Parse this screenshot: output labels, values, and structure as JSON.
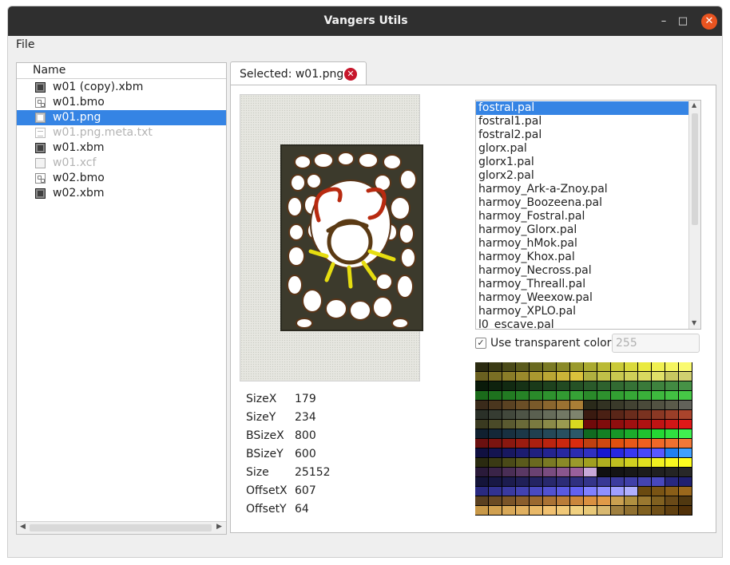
{
  "window": {
    "title": "Vangers Utils"
  },
  "window_controls": {
    "minimize": "–",
    "maximize": "□",
    "close": "✕"
  },
  "menubar": {
    "file": "File"
  },
  "file_tree": {
    "header": "Name",
    "items": [
      {
        "label": "w01 (copy).xbm",
        "icon": "image-file-icon",
        "selected": false,
        "dimmed": false
      },
      {
        "label": "w01.bmo",
        "icon": "binary-file-icon",
        "selected": false,
        "dimmed": false
      },
      {
        "label": "w01.png",
        "icon": "image-file-icon",
        "selected": true,
        "dimmed": false
      },
      {
        "label": "w01.png.meta.txt",
        "icon": "text-file-icon",
        "selected": false,
        "dimmed": true
      },
      {
        "label": "w01.xbm",
        "icon": "image-file-icon",
        "selected": false,
        "dimmed": false
      },
      {
        "label": "w01.xcf",
        "icon": "xcf-file-icon",
        "selected": false,
        "dimmed": true
      },
      {
        "label": "w02.bmo",
        "icon": "binary-file-icon",
        "selected": false,
        "dimmed": false
      },
      {
        "label": "w02.xbm",
        "icon": "image-file-icon",
        "selected": false,
        "dimmed": false
      }
    ]
  },
  "tab": {
    "label": "Selected: w01.png"
  },
  "properties": [
    {
      "key": "SizeX",
      "value": "179"
    },
    {
      "key": "SizeY",
      "value": "234"
    },
    {
      "key": "BSizeX",
      "value": "800"
    },
    {
      "key": "BSizeY",
      "value": "600"
    },
    {
      "key": "Size",
      "value": "25152"
    },
    {
      "key": "OffsetX",
      "value": "607"
    },
    {
      "key": "OffsetY",
      "value": "64"
    }
  ],
  "palettes": {
    "selected": "fostral.pal",
    "items": [
      "fostral.pal",
      "fostral1.pal",
      "fostral2.pal",
      "glorx.pal",
      "glorx1.pal",
      "glorx2.pal",
      "harmoy_Ark-a-Znoy.pal",
      "harmoy_Boozeena.pal",
      "harmoy_Fostral.pal",
      "harmoy_Glorx.pal",
      "harmoy_hMok.pal",
      "harmoy_Khox.pal",
      "harmoy_Necross.pal",
      "harmoy_Threall.pal",
      "harmoy_Weexow.pal",
      "harmoy_XPLO.pal",
      "l0_escave.pal"
    ]
  },
  "transparency": {
    "label": "Use transparent color",
    "checked": true,
    "value": "255"
  },
  "palette_rows": [
    [
      "#2a2a10",
      "#3a3a14",
      "#4a4a18",
      "#5a5a1c",
      "#6a6a20",
      "#7a7a24",
      "#8a8a28",
      "#9a9a2c",
      "#aaaa30",
      "#baba34",
      "#caca38",
      "#dada3c",
      "#eaea40",
      "#f0f050",
      "#f5f560",
      "#fafa70"
    ],
    [
      "#6a6020",
      "#7a6e24",
      "#8a7c28",
      "#9a8a2c",
      "#aa9830",
      "#baa634",
      "#cab438",
      "#dac23c",
      "#b0b040",
      "#c0c048",
      "#c8c850",
      "#d0d058",
      "#d8d860",
      "#e0e068",
      "#c8c860",
      "#d0d070"
    ],
    [
      "#0a1a0a",
      "#0e220e",
      "#122a12",
      "#163216",
      "#1a3a1a",
      "#1e421e",
      "#224a22",
      "#265226",
      "#2a5a2a",
      "#2e622e",
      "#326a32",
      "#367236",
      "#3a7a3a",
      "#3e823e",
      "#428a42",
      "#469246"
    ],
    [
      "#1a6a1a",
      "#1e721e",
      "#227a22",
      "#268226",
      "#2a8a2a",
      "#2e922e",
      "#329a32",
      "#36a236",
      "#2a8a2a",
      "#2e922e",
      "#32a032",
      "#36a836",
      "#3ab03a",
      "#3eb83e",
      "#42c042",
      "#46c846"
    ],
    [
      "#3a2a1a",
      "#4a361e",
      "#5a4222",
      "#6a4e26",
      "#7a5a2a",
      "#8a662e",
      "#9a7232",
      "#aa7e36",
      "#2a2a1a",
      "#323222",
      "#3a3a2a",
      "#424232",
      "#4a4a3a",
      "#525242",
      "#5a5a4a",
      "#62625a"
    ],
    [
      "#2a3028",
      "#363c32",
      "#42483c",
      "#4e5446",
      "#5a6050",
      "#666c5a",
      "#727864",
      "#7e846e",
      "#3a1a10",
      "#4a2014",
      "#5a2618",
      "#6a2c1c",
      "#7a3220",
      "#8a3824",
      "#9a3e28",
      "#aa442c"
    ],
    [
      "#3a3a20",
      "#4a4a28",
      "#5a5a30",
      "#6a6a38",
      "#7a7a40",
      "#8a8a48",
      "#9a9a50",
      "#dada20",
      "#700a0a",
      "#800c0c",
      "#900e0e",
      "#a01010",
      "#b01212",
      "#c01414",
      "#d01616",
      "#e01818"
    ],
    [
      "#102030",
      "#142838",
      "#183040",
      "#1c3848",
      "#204050",
      "#244858",
      "#285060",
      "#2c5868",
      "#106a20",
      "#148024",
      "#189628",
      "#1cac2c",
      "#20c230",
      "#24d834",
      "#30e040",
      "#40f050"
    ],
    [
      "#6a1010",
      "#7a1410",
      "#8a1810",
      "#9a1c10",
      "#aa2010",
      "#ba2410",
      "#ca2810",
      "#da2c10",
      "#c04010",
      "#d04810",
      "#e05010",
      "#e85818",
      "#f06020",
      "#f06828",
      "#f07030",
      "#f07838"
    ],
    [
      "#101040",
      "#141450",
      "#181860",
      "#1c1c70",
      "#202080",
      "#242490",
      "#2828a0",
      "#2c2cb0",
      "#3030c0",
      "#1818d0",
      "#2828e0",
      "#3838f0",
      "#4848f8",
      "#5858ff",
      "#2080f0",
      "#40a0ff"
    ],
    [
      "#2a2a10",
      "#3a3a14",
      "#4a4a18",
      "#5a5a1c",
      "#6a6a20",
      "#7a7a24",
      "#8a8a28",
      "#9a9a2c",
      "#a0a020",
      "#b0b020",
      "#c0c020",
      "#d0d020",
      "#e0e020",
      "#f0f020",
      "#f8f820",
      "#ffff20"
    ],
    [
      "#2a1a3a",
      "#3a2448",
      "#4a2e56",
      "#5a3864",
      "#6a4272",
      "#7a4c80",
      "#8a568e",
      "#9a609c",
      "#c8a8d8",
      "#101010",
      "#141414",
      "#181818",
      "#1c1c1c",
      "#202020",
      "#242424",
      "#282828"
    ],
    [
      "#14143a",
      "#181844",
      "#1c1c4e",
      "#202058",
      "#242462",
      "#28286c",
      "#2c2c76",
      "#303080",
      "#34348a",
      "#383894",
      "#3c3c9e",
      "#4040a8",
      "#4444b2",
      "#4848bc",
      "#282880",
      "#202070"
    ],
    [
      "#2a2a80",
      "#323290",
      "#3a3aa0",
      "#4242b0",
      "#4a4ac0",
      "#5252d0",
      "#5a5ae0",
      "#6262f0",
      "#8080ff",
      "#9090ff",
      "#a0a0ff",
      "#b0b0ff",
      "#6a4a10",
      "#7a5414",
      "#8a5e18",
      "#9a681c"
    ],
    [
      "#5a4020",
      "#6a4a24",
      "#7a5428",
      "#8a5e2c",
      "#9a6830",
      "#aa7234",
      "#ba7c38",
      "#ca863c",
      "#da9040",
      "#e09a48",
      "#caa050",
      "#b09040",
      "#9a7830",
      "#806020",
      "#6a4a18",
      "#503810"
    ],
    [
      "#c89848",
      "#d0a050",
      "#d8a858",
      "#e0b060",
      "#e8b868",
      "#f0c070",
      "#f0c878",
      "#f0d080",
      "#e8c878",
      "#d8b870",
      "#a08040",
      "#907030",
      "#806020",
      "#705018",
      "#604010",
      "#503008"
    ]
  ]
}
